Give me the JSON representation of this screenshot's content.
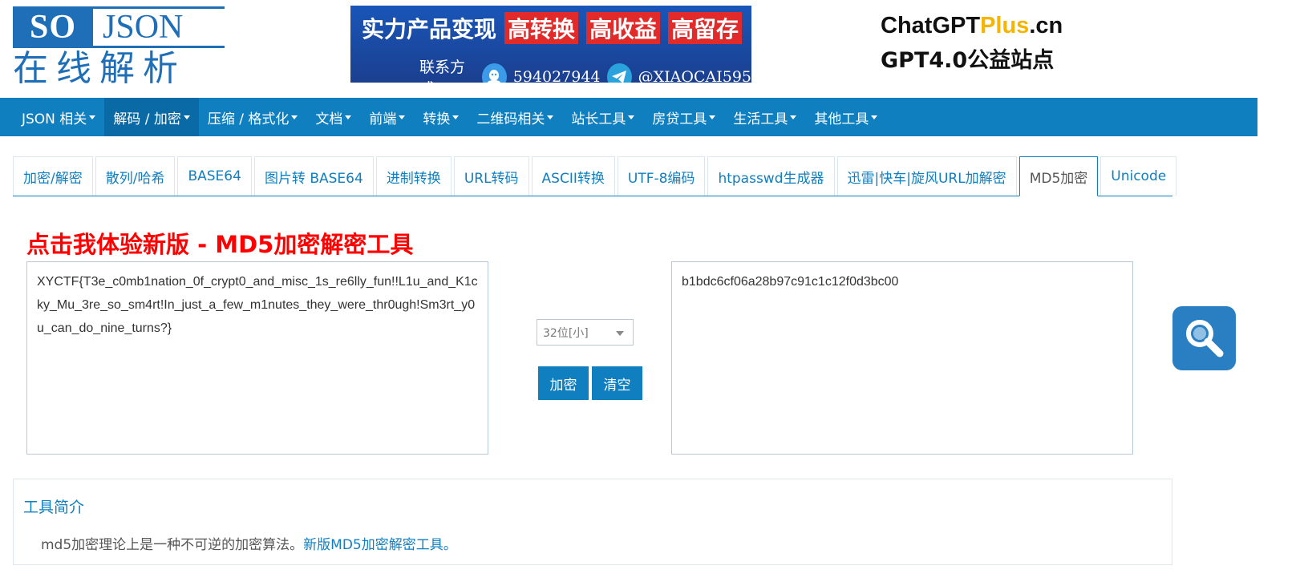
{
  "logo": {
    "latin_so": "SO",
    "latin_json": "JSON",
    "cn": "在线解析"
  },
  "banner": {
    "line1_plain": "实力产品变现",
    "tags": [
      "高转换",
      "高收益",
      "高留存"
    ],
    "contact_label": "联系方式",
    "qq_number": "594027944",
    "telegram": "@XIAOCAI595"
  },
  "promo": {
    "brand_a": "ChatGPT",
    "brand_b": "Plus",
    "brand_c": ".cn",
    "tagline": "GPT4.0公益站点"
  },
  "navbar": {
    "items": [
      {
        "label": "JSON 相关"
      },
      {
        "label": "解码 / 加密"
      },
      {
        "label": "压缩 / 格式化"
      },
      {
        "label": "文档"
      },
      {
        "label": "前端"
      },
      {
        "label": "转换"
      },
      {
        "label": "二维码相关"
      },
      {
        "label": "站长工具"
      },
      {
        "label": "房贷工具"
      },
      {
        "label": "生活工具"
      },
      {
        "label": "其他工具"
      }
    ],
    "active_index": 1
  },
  "tabs": {
    "items": [
      {
        "label": "加密/解密"
      },
      {
        "label": "散列/哈希"
      },
      {
        "label": "BASE64"
      },
      {
        "label": "图片转 BASE64"
      },
      {
        "label": "进制转换"
      },
      {
        "label": "URL转码"
      },
      {
        "label": "ASCII转换"
      },
      {
        "label": "UTF-8编码"
      },
      {
        "label": "htpasswd生成器"
      },
      {
        "label": "迅雷|快车|旋风URL加解密"
      },
      {
        "label": "MD5加密"
      },
      {
        "label": "Unicode"
      }
    ],
    "active_index": 10
  },
  "main": {
    "new_version_link": "点击我体验新版 - MD5加密解密工具",
    "input_text": "XYCTF{T3e_c0mb1nation_0f_crypt0_and_misc_1s_re6lly_fun!!L1u_and_K1cky_Mu_3re_so_sm4rt!In_just_a_few_m1nutes_they_were_thr0ugh!Sm3rt_y0u_can_do_nine_turns?}",
    "output_text": "b1bdc6cf06a28b97c91c1c12f0d3bc00",
    "select_value": "32位[小]",
    "encrypt_label": "加密",
    "clear_label": "清空"
  },
  "intro": {
    "title": "工具简介",
    "text": "md5加密理论上是一种不可逆的加密算法。",
    "link": "新版MD5加密解密工具。"
  },
  "colors": {
    "primary": "#0f7fc0",
    "red": "#ff0000",
    "search_bg": "#2a7fc3"
  },
  "icons": {
    "float": "search-icon",
    "qq": "qq-icon",
    "telegram": "telegram-icon"
  }
}
